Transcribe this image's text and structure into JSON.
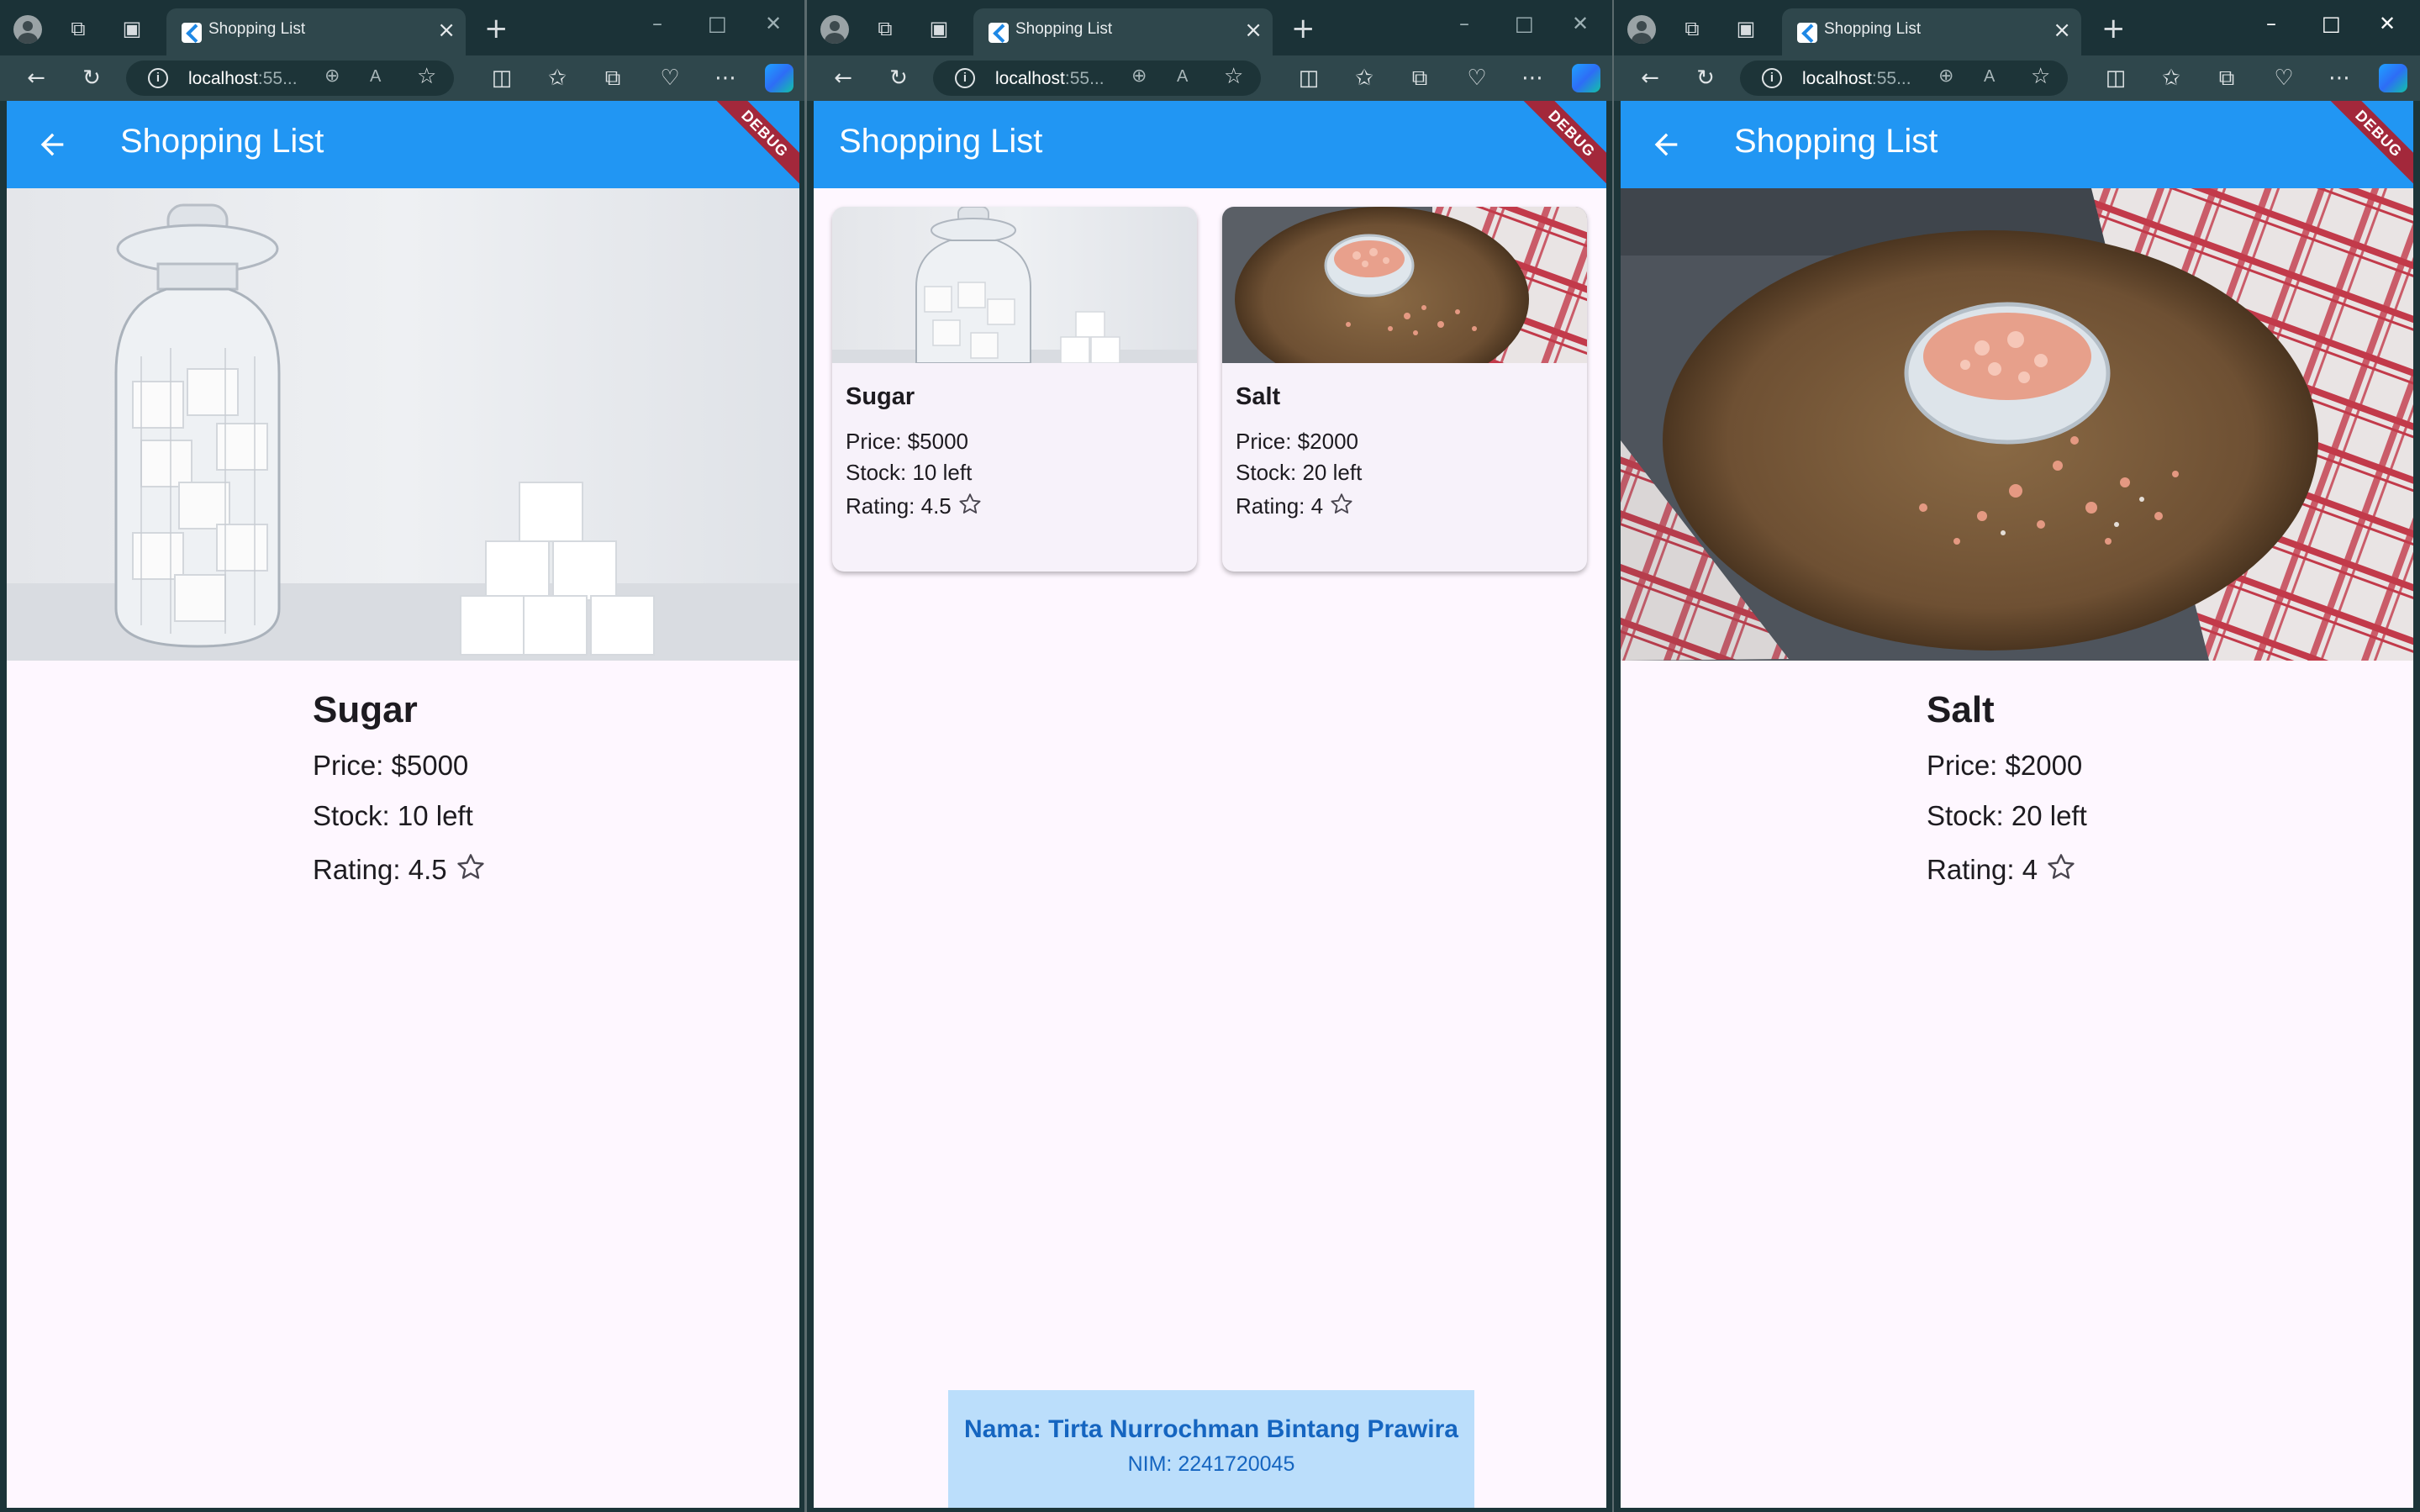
{
  "browser": {
    "tab_title": "Shopping List",
    "url_host": "localhost",
    "url_rest": ":55..."
  },
  "app": {
    "title": "Shopping List",
    "debug_banner": "DEBUG",
    "primary_color": "#2196f3",
    "background_color": "#fef7ff"
  },
  "products": [
    {
      "name": "Sugar",
      "price": "Price: $5000",
      "stock": "Stock: 10 left",
      "rating": "Rating: 4.5"
    },
    {
      "name": "Salt",
      "price": "Price: $2000",
      "stock": "Stock: 20 left",
      "rating": "Rating: 4"
    }
  ],
  "footer": {
    "name": "Nama: Tirta Nurrochman Bintang Prawira",
    "nim": "NIM: 2241720045"
  },
  "icons": {
    "back": "arrow-left-icon",
    "rating": "star-outline-icon"
  }
}
